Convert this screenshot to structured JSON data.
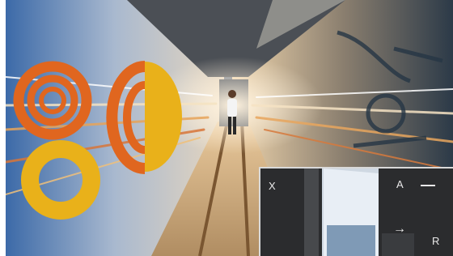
{
  "colors": {
    "logo_orange": "#e0661f",
    "logo_yellow": "#e9b11a",
    "tunnel_light": "#f2d7b0",
    "inset_bg": "#2a2b2d"
  },
  "inset": {
    "glyph_x": "X",
    "glyph_a": "A",
    "glyph_arrow": "→",
    "glyph_r": "R"
  }
}
